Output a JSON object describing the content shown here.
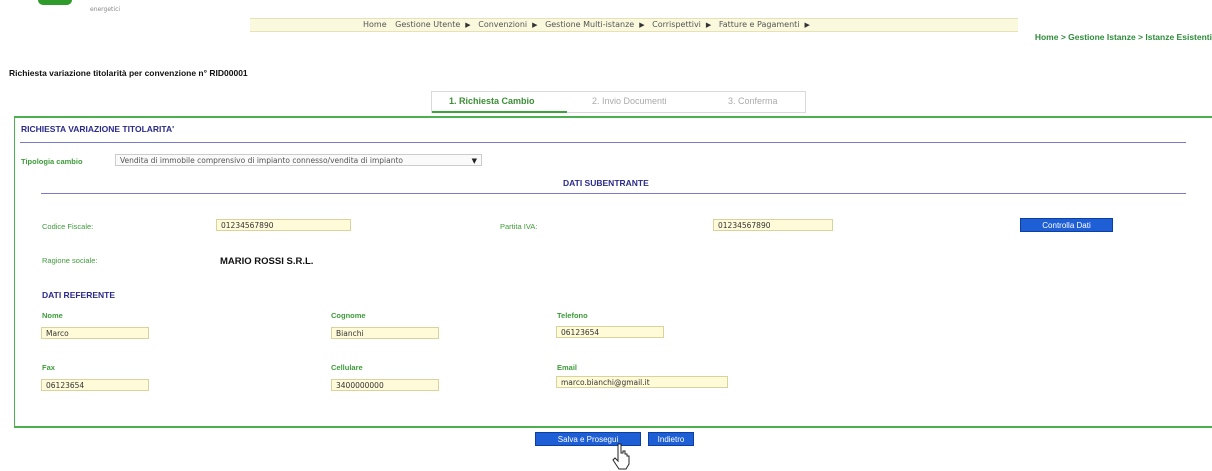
{
  "brand": {
    "tagline": "energetici"
  },
  "menu": [
    {
      "label": "Home"
    },
    {
      "label": "Gestione Utente"
    },
    {
      "label": "Convenzioni"
    },
    {
      "label": "Gestione Multi-istanze"
    },
    {
      "label": "Corrispettivi"
    },
    {
      "label": "Fatture e Pagamenti"
    }
  ],
  "breadcrumb": "Home > Gestione Istanze > Istanze Esistenti",
  "page_title": "Richiesta variazione titolarità per convenzione n° RID00001",
  "steps": [
    {
      "label": "1. Richiesta Cambio",
      "active": true
    },
    {
      "label": "2. Invio Documenti",
      "active": false
    },
    {
      "label": "3. Conferma",
      "active": false
    }
  ],
  "panel": {
    "title": "RICHIESTA VARIAZIONE TITOLARITA'",
    "tipologia_label": "Tipologia cambio",
    "tipologia_value": "Vendita di immobile comprensivo di impianto connesso/vendita di impianto",
    "subentrante_header": "DATI SUBENTRANTE",
    "codice_fiscale_label": "Codice Fiscale:",
    "codice_fiscale_value": "01234567890",
    "partita_iva_label": "Partita IVA:",
    "partita_iva_value": "01234567890",
    "controlla_button": "Controlla Dati",
    "ragione_sociale_label": "Ragione sociale:",
    "ragione_sociale_value": "MARIO ROSSI S.R.L.",
    "referente_header": "DATI REFERENTE",
    "nome_label": "Nome",
    "nome_value": "Marco",
    "cognome_label": "Cognome",
    "cognome_value": "Bianchi",
    "telefono_label": "Telefono",
    "telefono_value": "06123654",
    "fax_label": "Fax",
    "fax_value": "06123654",
    "cellulare_label": "Cellulare",
    "cellulare_value": "3400000000",
    "email_label": "Email",
    "email_value": "marco.bianchi@gmail.it"
  },
  "actions": {
    "save": "Salva e Prosegui",
    "back": "Indietro"
  },
  "colors": {
    "accent_green": "#3e9b3a",
    "header_blue": "#2a2a8a",
    "button_blue": "#1f5fd6",
    "input_bg": "#fffbd9"
  }
}
